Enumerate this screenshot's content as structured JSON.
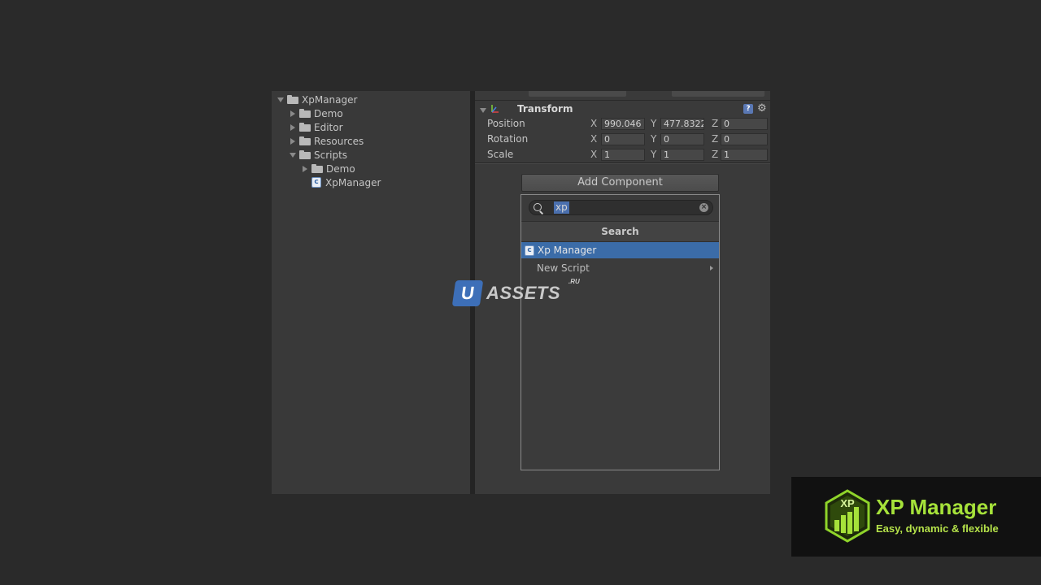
{
  "project": {
    "tree": [
      {
        "label": "XpManager",
        "type": "folder",
        "expanded": true,
        "depth": 0
      },
      {
        "label": "Demo",
        "type": "folder",
        "expanded": false,
        "depth": 1
      },
      {
        "label": "Editor",
        "type": "folder",
        "expanded": false,
        "depth": 1
      },
      {
        "label": "Resources",
        "type": "folder",
        "expanded": false,
        "depth": 1
      },
      {
        "label": "Scripts",
        "type": "folder",
        "expanded": true,
        "depth": 1
      },
      {
        "label": "Demo",
        "type": "folder",
        "expanded": false,
        "depth": 2
      },
      {
        "label": "XpManager",
        "type": "script",
        "depth": 2
      }
    ]
  },
  "inspector": {
    "transform": {
      "title": "Transform",
      "rows": [
        {
          "label": "Position",
          "x": "990.046",
          "y": "477.8322",
          "z": "0"
        },
        {
          "label": "Rotation",
          "x": "0",
          "y": "0",
          "z": "0"
        },
        {
          "label": "Scale",
          "x": "1",
          "y": "1",
          "z": "1"
        }
      ],
      "axis_x": "X",
      "axis_y": "Y",
      "axis_z": "Z"
    },
    "add_component_label": "Add Component"
  },
  "popup": {
    "search_value": "xp",
    "header": "Search",
    "results": [
      {
        "label": "Xp Manager",
        "selected": true
      },
      {
        "label": "New Script",
        "has_submenu": true
      }
    ]
  },
  "watermark": {
    "badge": "U",
    "text": "ASSETS",
    "suffix": ".RU"
  },
  "promo": {
    "logo_text": "XP",
    "title": "XP Manager",
    "subtitle": "Easy, dynamic & flexible",
    "accent_color": "#a6e23a"
  },
  "colors": {
    "selection": "#3b6ca8",
    "panel_bg": "#3a3a3a"
  }
}
